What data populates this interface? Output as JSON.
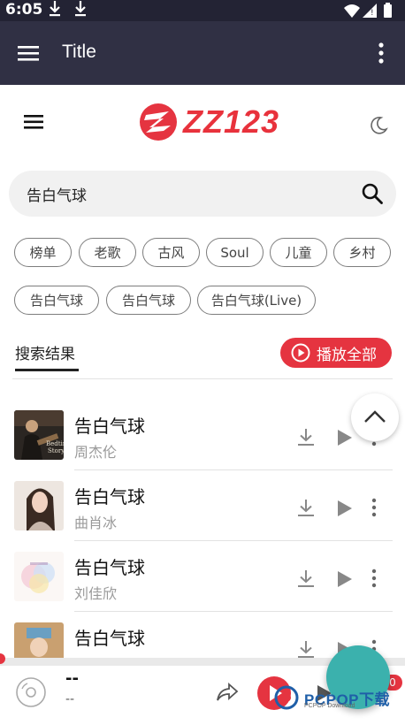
{
  "status_bar": {
    "time": "6:05"
  },
  "app_bar": {
    "title": "Title"
  },
  "site": {
    "logo_text": "ZZ123",
    "accent_color": "#e53440"
  },
  "search": {
    "value": "告白气球"
  },
  "genre_chips": [
    "榜单",
    "老歌",
    "古风",
    "Soul",
    "儿童",
    "乡村"
  ],
  "suggestion_chips": [
    "告白气球",
    "告白气球",
    "告白气球(Live)"
  ],
  "results": {
    "title": "搜索结果",
    "play_all_label": "播放全部"
  },
  "songs": [
    {
      "title": "告白气球",
      "artist": "周杰伦"
    },
    {
      "title": "告白气球",
      "artist": "曲肖冰"
    },
    {
      "title": "告白气球",
      "artist": "刘佳欣"
    },
    {
      "title": "告白气球",
      "artist": ""
    }
  ],
  "player": {
    "title": "--",
    "subtitle": "--",
    "queue_count": "0"
  },
  "watermark": {
    "text": "PCPOP下载",
    "sub": "PCPOP Download"
  }
}
